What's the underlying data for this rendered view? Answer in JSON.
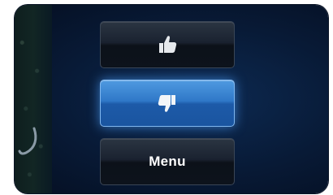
{
  "buttons": {
    "thumbs_up": {
      "icon": "thumbs-up-icon"
    },
    "thumbs_down": {
      "icon": "thumbs-down-icon",
      "state": "selected"
    },
    "menu": {
      "label": "Menu"
    }
  },
  "colors": {
    "background": "#081a36",
    "button_dark": "#1a2230",
    "button_active": "#2f78c8",
    "icon_light": "#dfe3e8"
  }
}
